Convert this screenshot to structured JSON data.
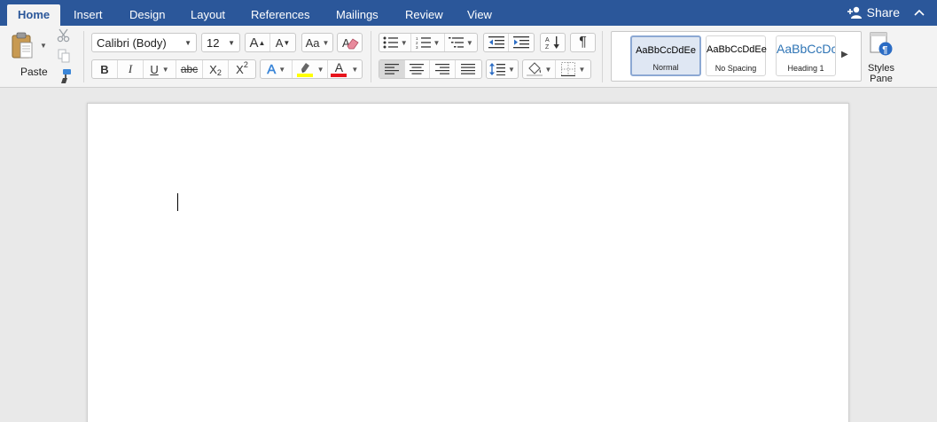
{
  "tabs": [
    {
      "label": "Home",
      "active": true
    },
    {
      "label": "Insert"
    },
    {
      "label": "Design"
    },
    {
      "label": "Layout"
    },
    {
      "label": "References"
    },
    {
      "label": "Mailings"
    },
    {
      "label": "Review"
    },
    {
      "label": "View"
    }
  ],
  "share_label": "Share",
  "clipboard": {
    "paste_label": "Paste"
  },
  "font": {
    "name": "Calibri (Body)",
    "size": "12"
  },
  "format": {
    "bold": "B",
    "italic": "I",
    "underline": "U",
    "strikethrough": "abc",
    "subscript_base": "X",
    "subscript_mark": "2",
    "superscript_base": "X",
    "superscript_mark": "2",
    "grow_font": "A",
    "shrink_font": "A",
    "change_case": "Aa",
    "text_effects": "A",
    "font_color": "A"
  },
  "paragraph": {
    "show_marks": "¶"
  },
  "styles": [
    {
      "sample": "AaBbCcDdEe",
      "name": "Normal",
      "selected": true
    },
    {
      "sample": "AaBbCcDdEe",
      "name": "No Spacing"
    },
    {
      "sample": "AaBbCcDc",
      "name": "Heading 1"
    }
  ],
  "styles_pane_label_1": "Styles",
  "styles_pane_label_2": "Pane",
  "colors": {
    "brand": "#2b579a",
    "highlight": "#ffff00",
    "font_color": "#e8141c",
    "text_effects": "#3b86d8"
  }
}
